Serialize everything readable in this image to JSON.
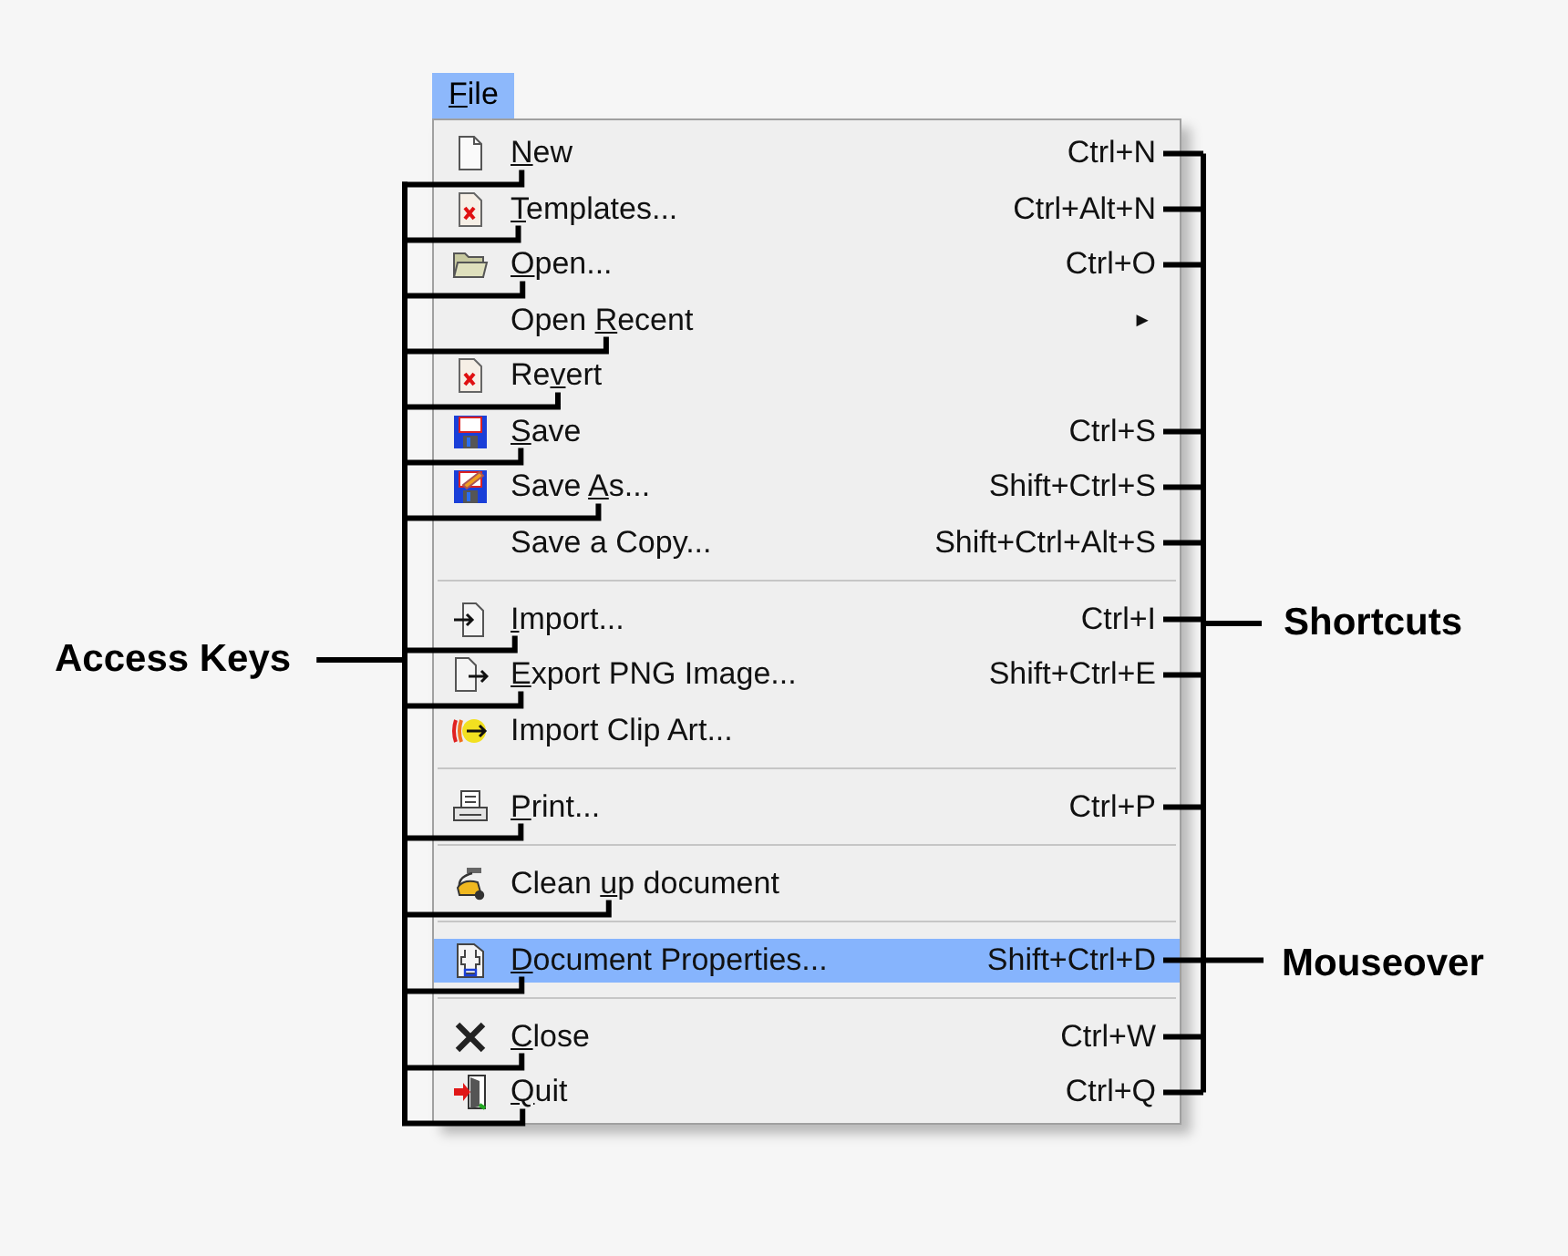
{
  "menu_title": {
    "key": "F",
    "after": "ile"
  },
  "menu": {
    "groups": [
      [
        {
          "kind": "item",
          "key": "N",
          "after": "ew",
          "shortcut": "Ctrl+N",
          "selected": false
        },
        {
          "kind": "item",
          "key": "T",
          "after": "emplates...",
          "shortcut": "Ctrl+Alt+N",
          "selected": false
        },
        {
          "kind": "item",
          "key": "O",
          "after": "pen...",
          "shortcut": "Ctrl+O",
          "selected": false
        },
        {
          "kind": "submenu",
          "before": "Open ",
          "key": "R",
          "after": "ecent",
          "arrow": "►",
          "selected": false
        },
        {
          "kind": "item",
          "before": "Re",
          "key": "v",
          "after": "ert",
          "selected": false
        },
        {
          "kind": "item",
          "key": "S",
          "after": "ave",
          "shortcut": "Ctrl+S",
          "selected": false
        },
        {
          "kind": "item",
          "before": "Save ",
          "key": "A",
          "after": "s...",
          "shortcut": "Shift+Ctrl+S",
          "selected": false
        },
        {
          "kind": "item",
          "before": "Save a Copy...",
          "shortcut": "Shift+Ctrl+Alt+S",
          "selected": false
        }
      ],
      [
        {
          "kind": "item",
          "key": "I",
          "after": "mport...",
          "shortcut": "Ctrl+I",
          "selected": false
        },
        {
          "kind": "item",
          "key": "E",
          "after": "xport PNG Image...",
          "shortcut": "Shift+Ctrl+E",
          "selected": false
        },
        {
          "kind": "item",
          "before": "Import Clip Art...",
          "selected": false
        }
      ],
      [
        {
          "kind": "item",
          "key": "P",
          "after": "rint...",
          "shortcut": "Ctrl+P",
          "selected": false
        }
      ],
      [
        {
          "kind": "item",
          "before": "Clean ",
          "key": "u",
          "after": "p document",
          "selected": false
        }
      ],
      [
        {
          "kind": "item",
          "key": "D",
          "after": "ocument Properties...",
          "shortcut": "Shift+Ctrl+D",
          "selected": true
        }
      ],
      [
        {
          "kind": "item",
          "key": "C",
          "after": "lose",
          "shortcut": "Ctrl+W",
          "selected": false
        },
        {
          "kind": "item",
          "key": "Q",
          "after": "uit",
          "shortcut": "Ctrl+Q",
          "selected": false
        }
      ]
    ]
  },
  "annotations": [
    {
      "kind": "access_keys",
      "text": "Access Keys"
    },
    {
      "kind": "shortcuts",
      "text": "Shortcuts"
    },
    {
      "kind": "mouseover",
      "text": "Mouseover"
    }
  ]
}
